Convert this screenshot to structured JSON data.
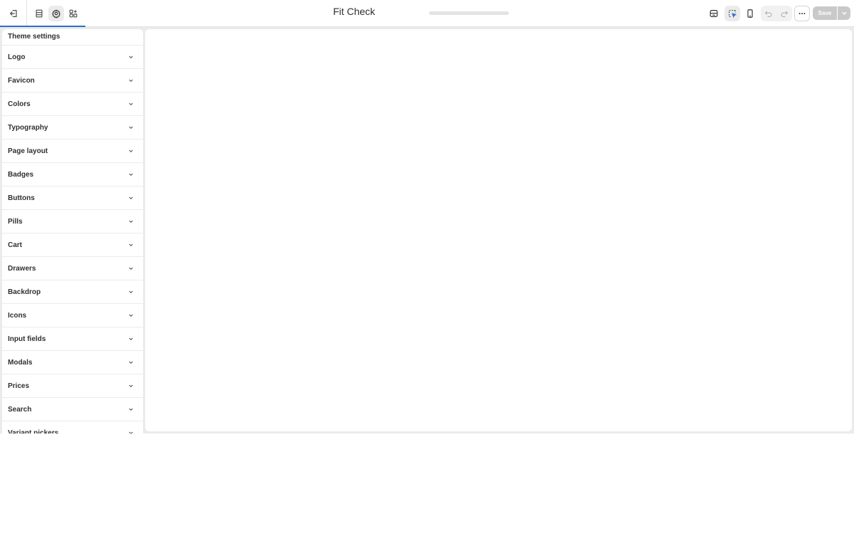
{
  "header": {
    "title": "Fit Check",
    "save_label": "Save",
    "loading_progress": 0.0
  },
  "icons": {
    "exit": "exit-icon",
    "sections": "sections-icon",
    "theme_settings": "theme-settings-icon",
    "app_embeds": "app-embeds-icon",
    "desktop_preview": "desktop-icon",
    "inspector": "inspector-icon",
    "mobile_preview": "mobile-icon",
    "undo": "undo-icon",
    "redo": "redo-icon",
    "more": "more-icon",
    "caret": "chevron-down-icon"
  },
  "colors": {
    "accent": "#2c6ecb",
    "canvas_bg": "#ebebeb",
    "save_disabled": "#c9c9c9"
  },
  "sidebar": {
    "title": "Theme settings",
    "sections": [
      {
        "label": "Logo"
      },
      {
        "label": "Favicon"
      },
      {
        "label": "Colors"
      },
      {
        "label": "Typography"
      },
      {
        "label": "Page layout"
      },
      {
        "label": "Badges"
      },
      {
        "label": "Buttons"
      },
      {
        "label": "Pills"
      },
      {
        "label": "Cart"
      },
      {
        "label": "Drawers"
      },
      {
        "label": "Backdrop"
      },
      {
        "label": "Icons"
      },
      {
        "label": "Input fields"
      },
      {
        "label": "Modals"
      },
      {
        "label": "Prices"
      },
      {
        "label": "Search"
      },
      {
        "label": "Variant pickers"
      }
    ]
  }
}
